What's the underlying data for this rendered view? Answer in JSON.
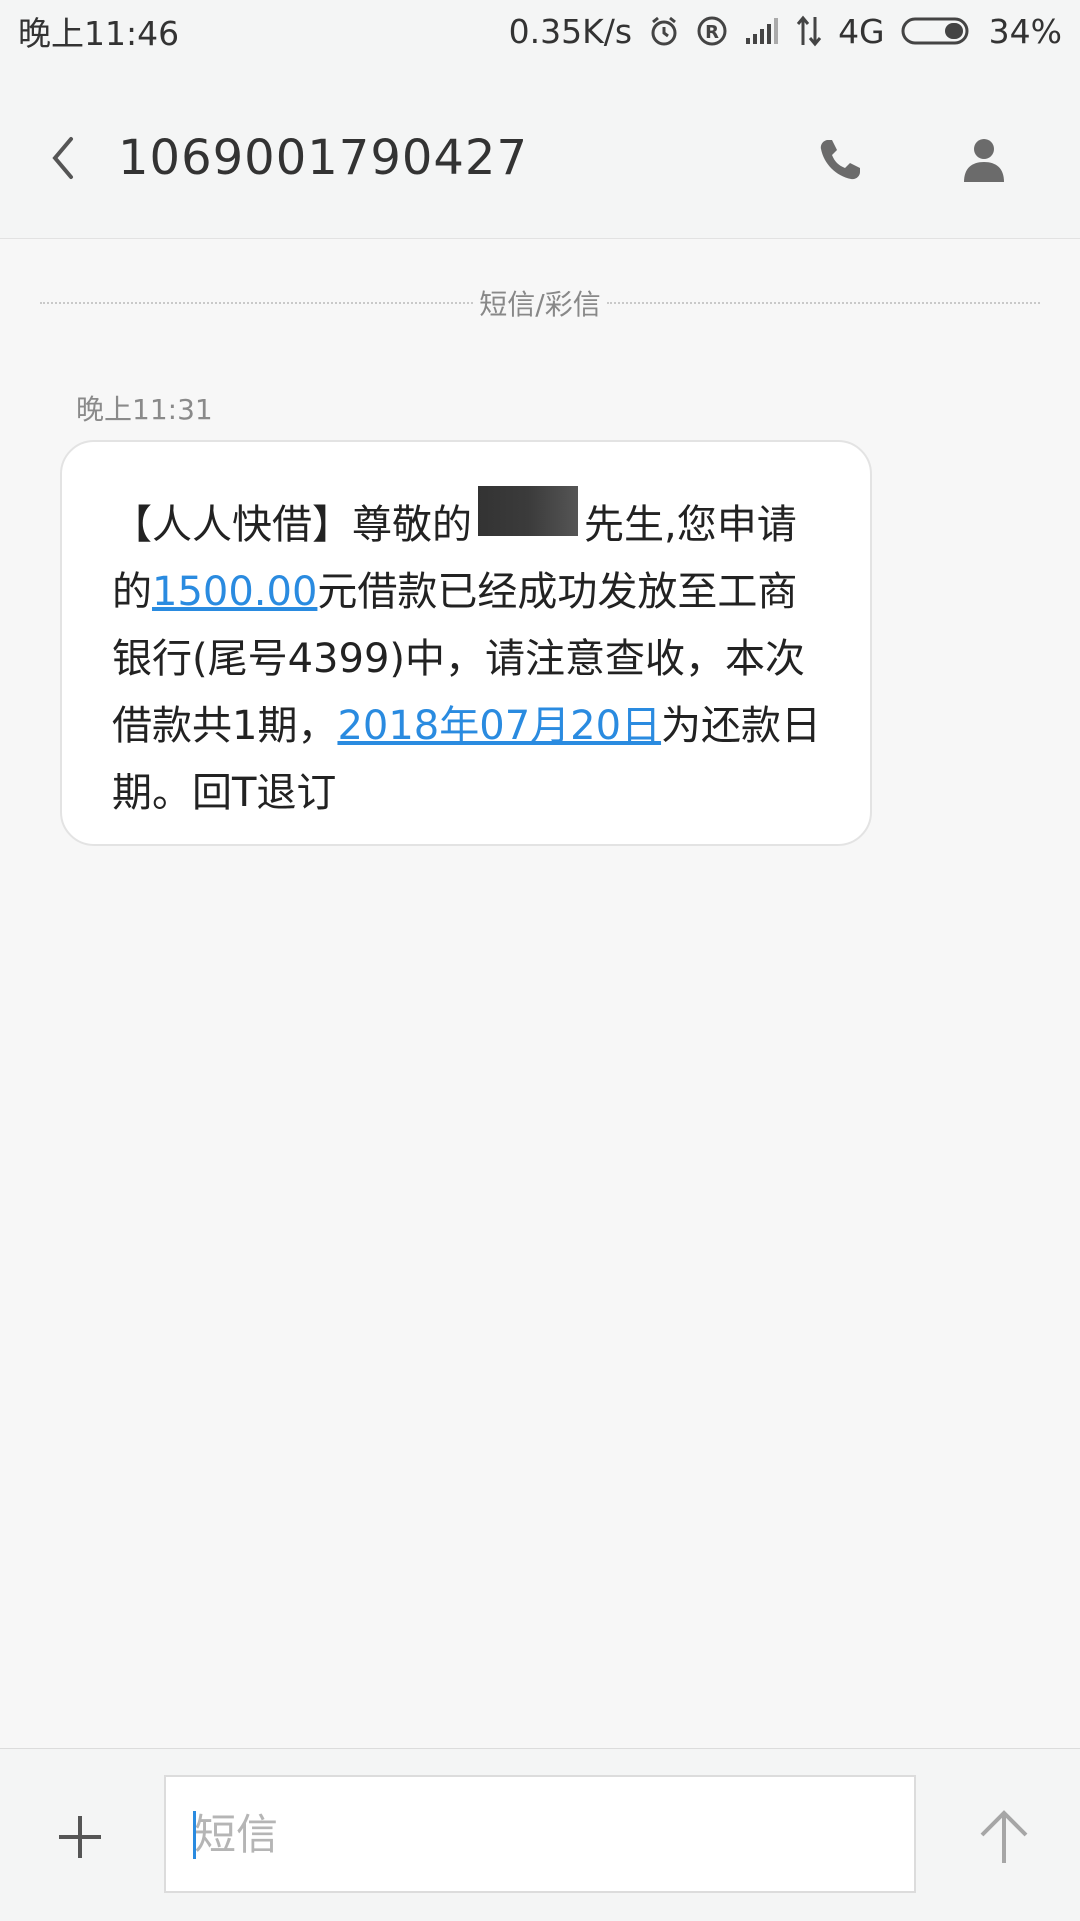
{
  "status_bar": {
    "time": "晚上11:46",
    "net_speed": "0.35K/s",
    "network": "4G",
    "battery": "34%",
    "icons": [
      "alarm-icon",
      "registered-icon",
      "signal-icon",
      "data-arrows-icon",
      "battery-icon"
    ]
  },
  "header": {
    "title": "1069001790427",
    "back_icon": "chevron-left-icon",
    "call_icon": "phone-icon",
    "contact_icon": "person-icon"
  },
  "divider": {
    "label": "短信/彩信"
  },
  "message": {
    "time": "晚上11:31",
    "part1": "【人人快借】尊敬的",
    "part2": "先生,您申请的",
    "amount_link": "1500.00",
    "part3": "元借款已经成功发放至工商银行(尾号4399)中，请注意查收，本次借款共1期，",
    "date_link": "2018年07月20日",
    "part4": "为还款日期。回T退订"
  },
  "input_bar": {
    "placeholder": "短信",
    "add_icon": "plus-icon",
    "send_icon": "arrow-up-icon"
  },
  "colors": {
    "link": "#2a8be0",
    "background": "#f7f7f7",
    "bar": "#f4f5f5"
  }
}
